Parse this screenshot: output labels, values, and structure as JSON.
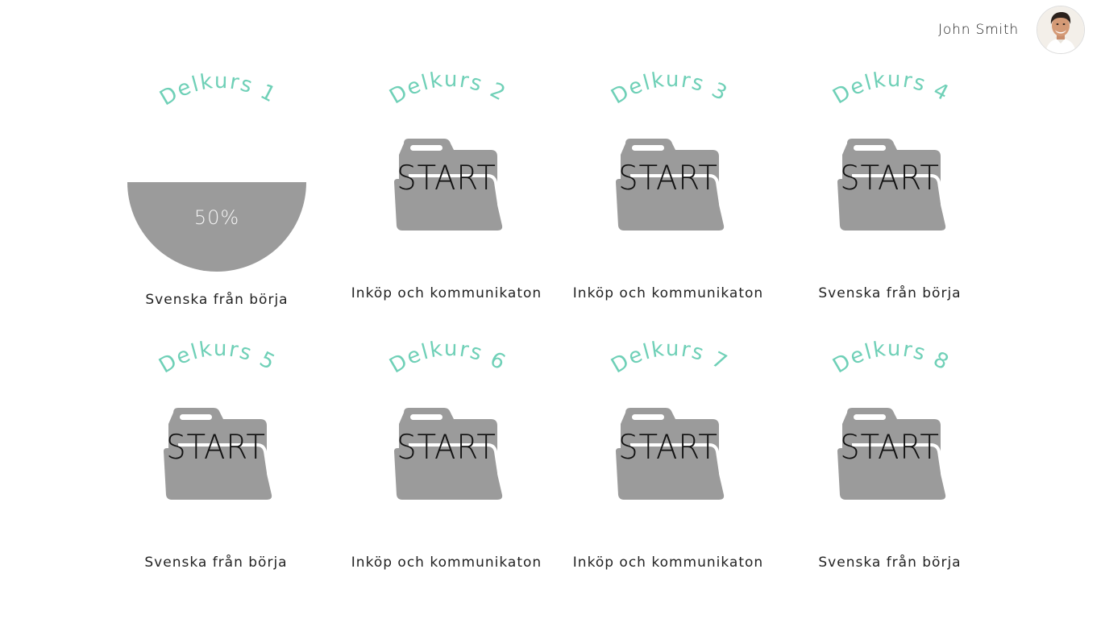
{
  "user": {
    "name": "John Smith"
  },
  "colors": {
    "accent": "#6fd0b7",
    "folder": "#9b9b9b",
    "background": "#ffffff"
  },
  "courses": [
    {
      "title": "Delkurs 1",
      "subtitle": "Svenska från börja",
      "progress": "50%",
      "started": true
    },
    {
      "title": "Delkurs 2",
      "subtitle": "Inköp och kommunikaton",
      "action": "START"
    },
    {
      "title": "Delkurs 3",
      "subtitle": "Inköp och kommunikaton",
      "action": "START"
    },
    {
      "title": "Delkurs 4",
      "subtitle": "Svenska från börja",
      "action": "START"
    },
    {
      "title": "Delkurs 5",
      "subtitle": "Svenska från börja",
      "action": "START"
    },
    {
      "title": "Delkurs 6",
      "subtitle": "Inköp och kommunikaton",
      "action": "START"
    },
    {
      "title": "Delkurs 7",
      "subtitle": "Inköp och kommunikaton",
      "action": "START"
    },
    {
      "title": "Delkurs 8",
      "subtitle": "Svenska från börja",
      "action": "START"
    }
  ]
}
